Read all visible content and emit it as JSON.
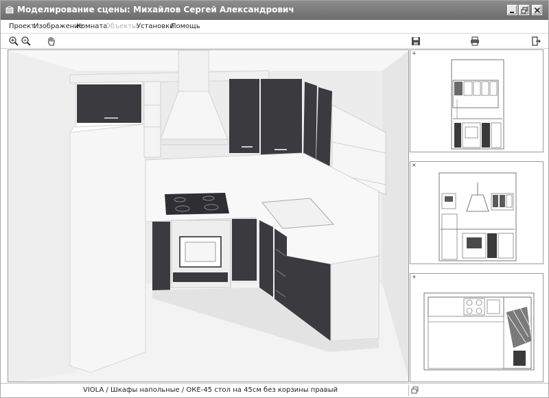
{
  "window": {
    "title": "Моделирование сцены: Михайлов Сергей Александрович"
  },
  "menu": {
    "items": [
      {
        "label": "Проект",
        "enabled": true
      },
      {
        "label": "Изображение",
        "enabled": true
      },
      {
        "label": "Комната",
        "enabled": true
      },
      {
        "label": "Объекты",
        "enabled": false
      },
      {
        "label": "Установки",
        "enabled": true
      },
      {
        "label": "Помощь",
        "enabled": true
      }
    ]
  },
  "toolbar": {
    "icons": [
      "zoom-in-icon",
      "zoom-out-icon",
      "pan-hand-icon",
      "save-icon",
      "print-icon",
      "exit-icon"
    ]
  },
  "side_panel": {
    "pane_markers": [
      "+",
      "×",
      "+"
    ]
  },
  "status": {
    "text": "VIOLA / Шкафы напольные / ОКЕ-45 стол на 45см без корзины правый"
  },
  "colors": {
    "cabinet_front": "#3a3a3f",
    "counter": "#f4f4f4",
    "wall": "#e9e9e9",
    "titlebar": "#7a7a7a"
  }
}
